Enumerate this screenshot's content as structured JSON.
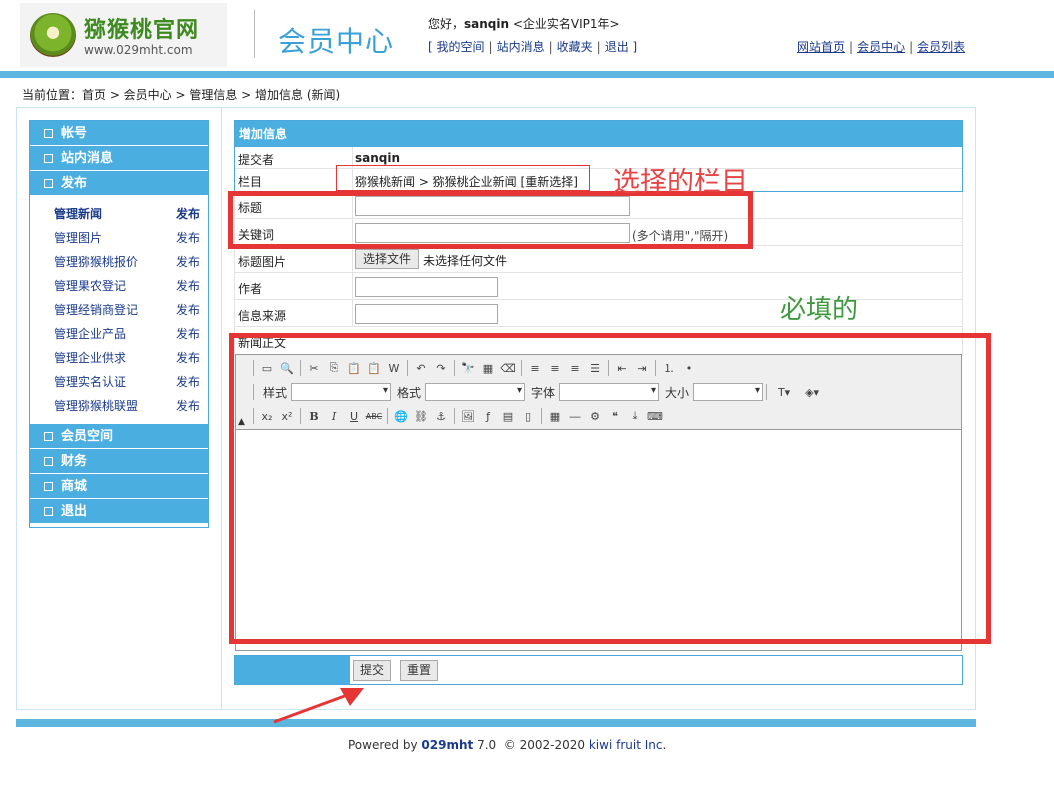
{
  "header": {
    "logo_text": "猕猴桃官网",
    "logo_url": "www.029mht.com",
    "center_title": "会员中心",
    "greeting_prefix": "您好，",
    "username": "sanqin",
    "membership": "<企业实名VIP1年>",
    "user_links": [
      "我的空间",
      "站内消息",
      "收藏夹",
      "退出"
    ],
    "right_links": [
      "网站首页",
      "会员中心",
      "会员列表"
    ]
  },
  "breadcrumb": "当前位置：首页 > 会员中心 > 管理信息 > 增加信息 (新闻)",
  "sidebar": {
    "top_categories": [
      "帐号",
      "站内消息",
      "发布"
    ],
    "sub_items": [
      {
        "name": "管理新闻",
        "action": "发布",
        "active": true
      },
      {
        "name": "管理图片",
        "action": "发布"
      },
      {
        "name": "管理猕猴桃报价",
        "action": "发布"
      },
      {
        "name": "管理果农登记",
        "action": "发布"
      },
      {
        "name": "管理经销商登记",
        "action": "发布"
      },
      {
        "name": "管理企业产品",
        "action": "发布"
      },
      {
        "name": "管理企业供求",
        "action": "发布"
      },
      {
        "name": "管理实名认证",
        "action": "发布"
      },
      {
        "name": "管理猕猴桃联盟",
        "action": "发布"
      }
    ],
    "bottom_categories": [
      "会员空间",
      "财务",
      "商城",
      "退出"
    ]
  },
  "form": {
    "heading": "增加信息",
    "submitter_label": "提交者",
    "submitter_value": "sanqin",
    "column_label": "栏目",
    "column_value": "猕猴桃新闻 > 猕猴桃企业新闻",
    "reselect": "[重新选择]",
    "title_label": "标题",
    "keywords_label": "关键词",
    "keywords_hint": "(多个请用\",\"隔开)",
    "image_label": "标题图片",
    "file_button": "选择文件",
    "file_status": "未选择任何文件",
    "author_label": "作者",
    "source_label": "信息来源",
    "body_label": "新闻正文",
    "submit": "提交",
    "reset": "重置"
  },
  "editor": {
    "style_label": "样式",
    "format_label": "格式",
    "font_label": "字体",
    "size_label": "大小"
  },
  "annotations": {
    "column_note": "选择的栏目",
    "required_note": "必填的"
  },
  "footer": {
    "powered": "Powered by",
    "brand": "029mht",
    "version": "7.0",
    "copyright": "© 2002-2020",
    "company": "kiwi fruit Inc."
  },
  "colors": {
    "accent": "#4aaee0",
    "annotation_red": "#e63535",
    "annotation_green": "#3f9a3f"
  }
}
